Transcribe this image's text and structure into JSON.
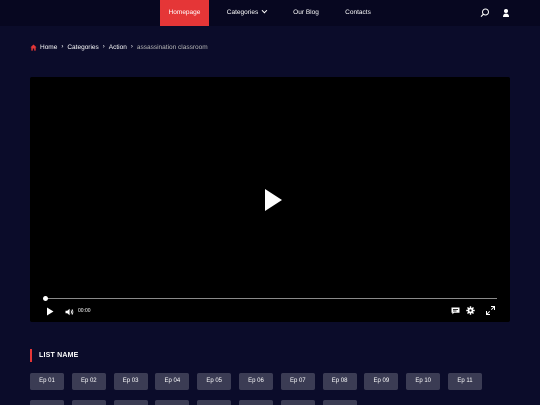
{
  "nav": {
    "home": "Homepage",
    "categories": "Categories",
    "blog": "Our Blog",
    "contacts": "Contacts"
  },
  "breadcrumb": {
    "home": "Home",
    "categories": "Categories",
    "action": "Action",
    "current": "assassination classroom"
  },
  "player": {
    "time": "00:00",
    "progress_fraction": 0
  },
  "list": {
    "title": "LIST NAME",
    "episodes": [
      "Ep 01",
      "Ep 02",
      "Ep 03",
      "Ep 04",
      "Ep 05",
      "Ep 06",
      "Ep 07",
      "Ep 08",
      "Ep 09",
      "Ep 10",
      "Ep 11",
      "",
      "",
      "",
      "",
      "",
      "",
      "",
      ""
    ]
  },
  "colors": {
    "accent": "#e53637",
    "background": "#0b0c2a"
  }
}
